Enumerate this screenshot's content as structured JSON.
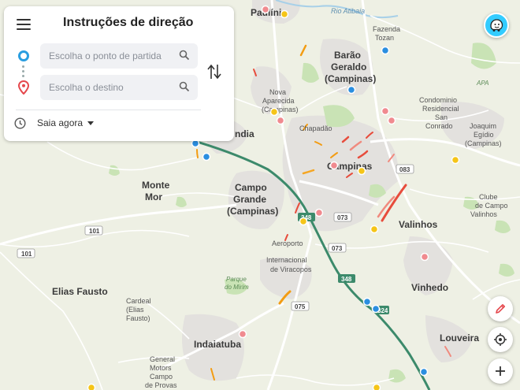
{
  "panel": {
    "title": "Instruções de direção",
    "origin_placeholder": "Escolha o ponto de partida",
    "destination_placeholder": "Escolha o destino",
    "departure_option": "Saia agora"
  },
  "map": {
    "places": {
      "paulinia": "Paulínia",
      "rio_atibaia": "Rio Atibaia",
      "fazenda_tozan_1": "Fazenda",
      "fazenda_tozan_2": "Tozan",
      "barao_1": "Barão",
      "barao_2": "Geraldo",
      "barao_3": "(Campinas)",
      "nova_aparecida_1": "Nova",
      "nova_aparecida_2": "Aparecida",
      "nova_aparecida_3": "(Campinas)",
      "chapadao": "Chapadão",
      "condominio_1": "Condominio",
      "condominio_2": "Residencial",
      "condominio_3": "San",
      "condominio_4": "Conrado",
      "joaquim_1": "Joaquim",
      "joaquim_2": "Egídio",
      "joaquim_3": "(Campinas)",
      "apa": "APA",
      "sumare_partial": "ndia",
      "campinas": "Campinas",
      "monte_mor_1": "Monte",
      "monte_mor_2": "Mor",
      "campo_grande_1": "Campo",
      "campo_grande_2": "Grande",
      "campo_grande_3": "(Campinas)",
      "valinhos": "Valinhos",
      "clube_1": "Clube",
      "clube_2": "de Campo",
      "clube_3": "Valinhos",
      "aeroporto_1": "Aeroporto",
      "aeroporto_2": "Internacional",
      "aeroporto_3": "de Viracopos",
      "parque_1": "Parque",
      "parque_2": "do Mirim",
      "elias_fausto": "Elias Fausto",
      "cardeal_1": "Cardeal",
      "cardeal_2": "(Elias",
      "cardeal_3": "Fausto)",
      "vinhedo": "Vinhedo",
      "indaiatuba": "Indaiatuba",
      "louveira": "Louveira",
      "general_1": "General",
      "general_2": "Motors",
      "general_3": "Campo",
      "general_4": "de Provas"
    },
    "shields": {
      "s101a": "101",
      "s101b": "101",
      "s083": "083",
      "s073a": "073",
      "s073b": "073",
      "s348a": "348",
      "s348b": "348",
      "s075": "075",
      "s324": "324"
    }
  },
  "icons": {
    "menu": "hamburger-menu-icon",
    "origin": "origin-circle-icon",
    "destination": "map-pin-icon",
    "search": "search-icon",
    "swap": "swap-arrows-icon",
    "clock": "clock-icon",
    "waze": "waze-logo-icon",
    "report": "pencil-icon",
    "locate": "crosshair-icon",
    "zoom_in": "plus-icon"
  },
  "colors": {
    "accent": "#2a9ee0",
    "pin": "#e5484d",
    "waze": "#33ccff",
    "highway": "#3c8a6b"
  }
}
